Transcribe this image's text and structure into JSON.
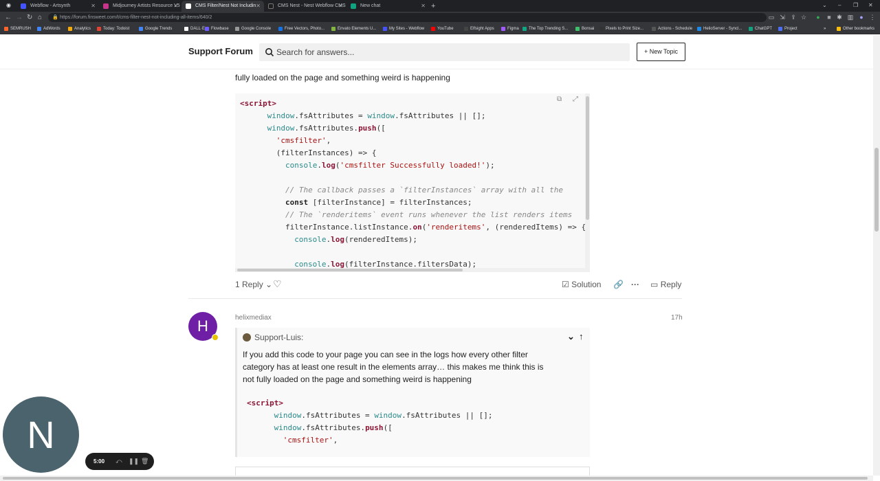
{
  "browser": {
    "tabs": [
      {
        "title": "Webflow - Artsynth",
        "color": "#4353ff"
      },
      {
        "title": "Midjourney Artists Resource V5",
        "color": "#c7358a"
      },
      {
        "title": "CMS Filter/Nest Not Includin",
        "color": "#ffffff"
      },
      {
        "title": "CMS Nest - Nest Webflow CMS",
        "color": "#1f1f1f"
      },
      {
        "title": "New chat",
        "color": "#10a37f"
      }
    ],
    "new_tab": "+",
    "url": "https://forum.finsweet.com/t/cms-filter-nest-not-including-all-items/640/2",
    "bookmarks": [
      {
        "label": "SEMRUSH",
        "color": "#ff642d"
      },
      {
        "label": "AdWords",
        "color": "#4285f4"
      },
      {
        "label": "Analytics",
        "color": "#f9ab00"
      },
      {
        "label": "Today: Todoist",
        "color": "#e44332"
      },
      {
        "label": "Google Trends",
        "color": "#4285f4"
      },
      {
        "label": "DALL·E",
        "color": "#ffffff"
      },
      {
        "label": "Flowbase",
        "color": "#6f5cff"
      },
      {
        "label": "Google Console",
        "color": "#999999"
      },
      {
        "label": "Free Vectors, Photo...",
        "color": "#1273eb"
      },
      {
        "label": "Envato Elements U...",
        "color": "#82b541"
      },
      {
        "label": "My Sites - Webflow",
        "color": "#4353ff"
      },
      {
        "label": "YouTube",
        "color": "#ff0000"
      },
      {
        "label": "Elfsight Apps",
        "color": "#444444"
      },
      {
        "label": "Figma",
        "color": "#a259ff"
      },
      {
        "label": "The Top Trending S...",
        "color": "#11a683"
      },
      {
        "label": "Bonsai",
        "color": "#3dc06c"
      },
      {
        "label": "Pixels to Print Size...",
        "color": "#333333"
      },
      {
        "label": "Actions - Schedule",
        "color": "#555555"
      },
      {
        "label": "HelioServer - Syncl...",
        "color": "#1e88e5"
      },
      {
        "label": "ChatGPT",
        "color": "#10a37f"
      },
      {
        "label": "Project",
        "color": "#4c6ef5"
      }
    ],
    "other_bookmarks": "Other bookmarks"
  },
  "forum": {
    "site_title": "Support Forum",
    "search_placeholder": "Search for answers...",
    "new_topic": "+ New Topic"
  },
  "post1": {
    "text_tail": "fully loaded on the page and something weird is happening",
    "code": [
      {
        "indent": 0,
        "parts": [
          [
            "tag",
            "<script>"
          ]
        ]
      },
      {
        "indent": 6,
        "parts": [
          [
            "prop",
            "window"
          ],
          [
            "plain",
            ".fsAttributes = "
          ],
          [
            "prop",
            "window"
          ],
          [
            "plain",
            ".fsAttributes || [];"
          ]
        ]
      },
      {
        "indent": 6,
        "parts": [
          [
            "prop",
            "window"
          ],
          [
            "plain",
            ".fsAttributes."
          ],
          [
            "fn",
            "push"
          ],
          [
            "plain",
            "(["
          ]
        ]
      },
      {
        "indent": 8,
        "parts": [
          [
            "str",
            "'cmsfilter'"
          ],
          [
            "plain",
            ","
          ]
        ]
      },
      {
        "indent": 8,
        "parts": [
          [
            "plain",
            "(filterInstances) => {"
          ]
        ]
      },
      {
        "indent": 10,
        "parts": [
          [
            "prop",
            "console"
          ],
          [
            "plain",
            "."
          ],
          [
            "fn",
            "log"
          ],
          [
            "plain",
            "("
          ],
          [
            "str",
            "'cmsfilter Successfully loaded!'"
          ],
          [
            "plain",
            ");"
          ]
        ]
      },
      {
        "indent": 0,
        "parts": []
      },
      {
        "indent": 10,
        "parts": [
          [
            "com",
            "// The callback passes a `filterInstances` array with all the"
          ]
        ]
      },
      {
        "indent": 10,
        "parts": [
          [
            "kw",
            "const"
          ],
          [
            "plain",
            " [filterInstance] = filterInstances;"
          ]
        ]
      },
      {
        "indent": 10,
        "parts": [
          [
            "com",
            "// The `renderitems` event runs whenever the list renders items"
          ]
        ]
      },
      {
        "indent": 10,
        "parts": [
          [
            "plain",
            "filterInstance.listInstance."
          ],
          [
            "fn",
            "on"
          ],
          [
            "plain",
            "("
          ],
          [
            "str",
            "'renderitems'"
          ],
          [
            "plain",
            ", (renderedItems) => {"
          ]
        ]
      },
      {
        "indent": 12,
        "parts": [
          [
            "prop",
            "console"
          ],
          [
            "plain",
            "."
          ],
          [
            "fn",
            "log"
          ],
          [
            "plain",
            "(renderedItems);"
          ]
        ]
      },
      {
        "indent": 0,
        "parts": []
      },
      {
        "indent": 12,
        "parts": [
          [
            "prop",
            "console"
          ],
          [
            "plain",
            "."
          ],
          [
            "fn",
            "log"
          ],
          [
            "plain",
            "(filterInstance.filtersData);"
          ]
        ]
      }
    ],
    "actions": {
      "replies": "1 Reply",
      "solution": "Solution",
      "reply": "Reply"
    }
  },
  "post2": {
    "avatar_letter": "H",
    "avatar_color": "#6f1fa6",
    "username": "helixmediax",
    "time": "17h",
    "quote_author": "Support-Luis:",
    "quote_lines": [
      "If you add this code to your page you can see in the logs how every other filter",
      "category has at least one result in the elements array… this makes me think this is",
      "not fully loaded on the page and something weird is happening"
    ],
    "quote_code": [
      {
        "indent": 0,
        "parts": [
          [
            "tag",
            "<script>"
          ]
        ]
      },
      {
        "indent": 6,
        "parts": [
          [
            "prop",
            "window"
          ],
          [
            "plain",
            ".fsAttributes = "
          ],
          [
            "prop",
            "window"
          ],
          [
            "plain",
            ".fsAttributes || [];"
          ]
        ]
      },
      {
        "indent": 6,
        "parts": [
          [
            "prop",
            "window"
          ],
          [
            "plain",
            ".fsAttributes."
          ],
          [
            "fn",
            "push"
          ],
          [
            "plain",
            "(["
          ]
        ]
      },
      {
        "indent": 8,
        "parts": [
          [
            "str",
            "'cmsfilter'"
          ],
          [
            "plain",
            ","
          ]
        ]
      }
    ]
  },
  "recorder": {
    "avatar_letter": "N",
    "avatar_color": "#4b636c",
    "time": "5:00"
  }
}
